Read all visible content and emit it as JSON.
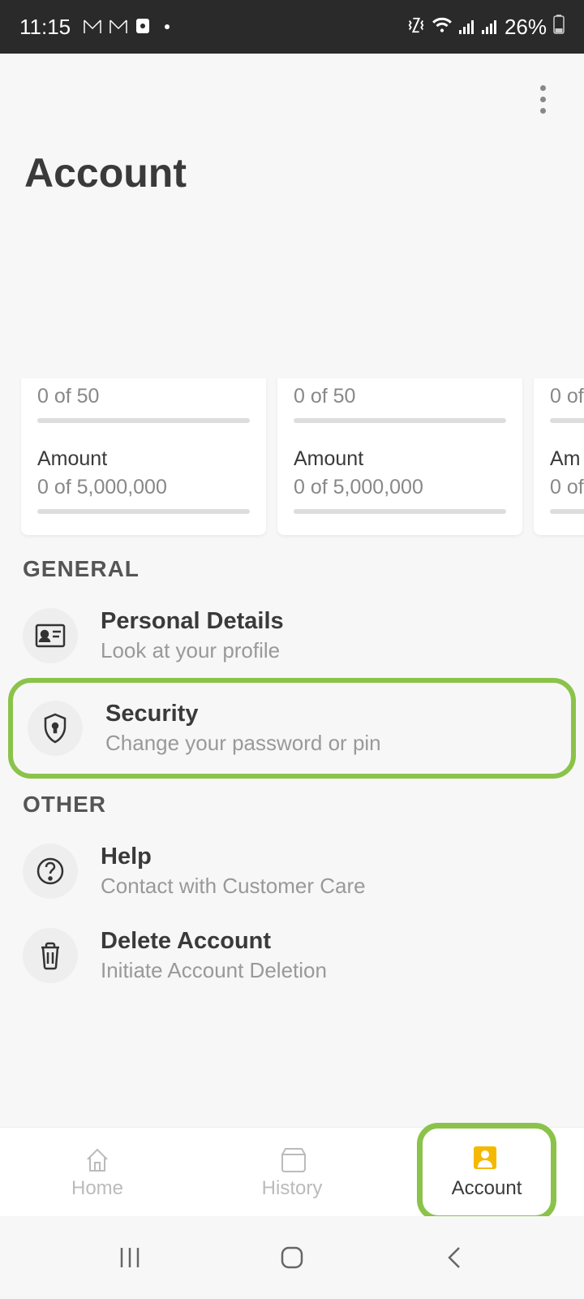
{
  "status_bar": {
    "time": "11:15",
    "battery": "26%"
  },
  "header": {
    "title": "Account"
  },
  "cards": [
    {
      "progress_text": "0 of 50",
      "amount_label": "Amount",
      "amount_text": "0 of 5,000,000"
    },
    {
      "progress_text": "0 of 50",
      "amount_label": "Amount",
      "amount_text": "0 of 5,000,000"
    },
    {
      "progress_text": "0 of",
      "amount_label": "Am",
      "amount_text": "0 of"
    }
  ],
  "sections": {
    "general": {
      "header": "GENERAL",
      "items": [
        {
          "title": "Personal Details",
          "subtitle": "Look at your profile"
        },
        {
          "title": "Security",
          "subtitle": "Change your password or pin"
        }
      ]
    },
    "other": {
      "header": "OTHER",
      "items": [
        {
          "title": "Help",
          "subtitle": "Contact with Customer Care"
        },
        {
          "title": "Delete Account",
          "subtitle": "Initiate Account Deletion"
        }
      ]
    }
  },
  "bottom_nav": {
    "home": "Home",
    "history": "History",
    "account": "Account"
  }
}
